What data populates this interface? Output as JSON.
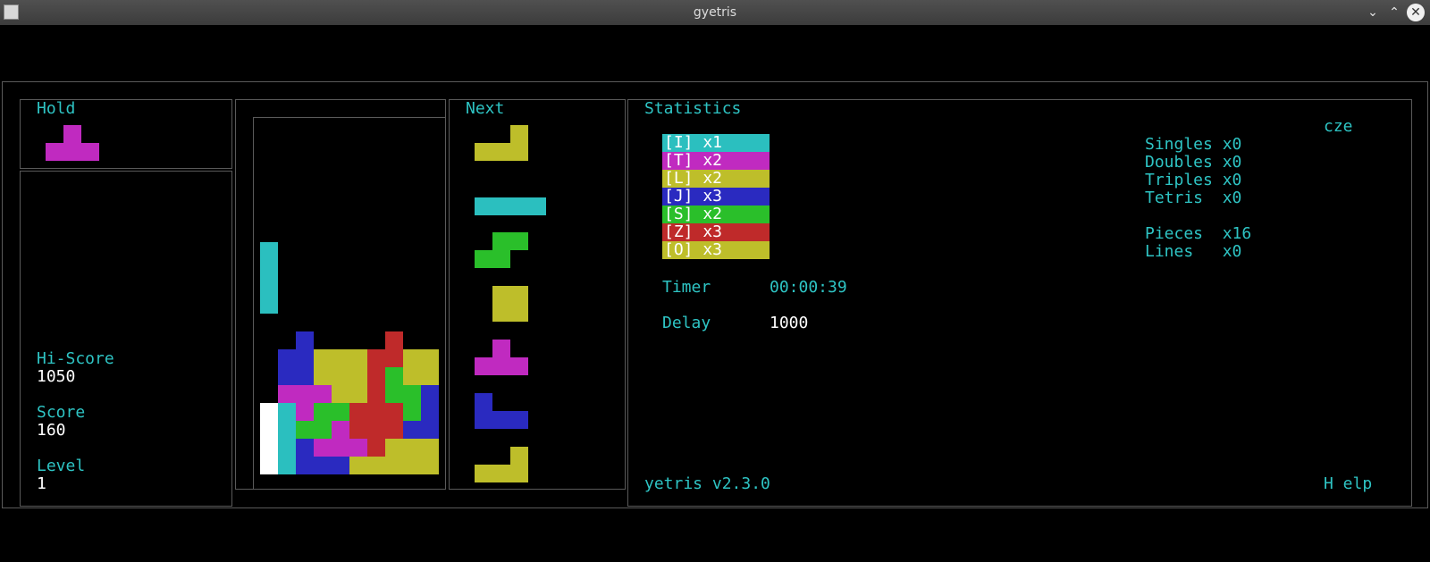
{
  "window": {
    "title": "gyetris"
  },
  "colors": {
    "I": "#2bbfbf",
    "T": "#c02ac0",
    "L": "#bebe2a",
    "J": "#2a2ac0",
    "S": "#2abf2a",
    "Z": "#bf2a2a",
    "O": "#bebe2a",
    "W": "#ffffff",
    "cyanText": "#2ec4c4"
  },
  "hold": {
    "label": "Hold",
    "piece": "T"
  },
  "scores": {
    "hiscore_label": "Hi-Score",
    "hiscore": "1050",
    "score_label": "Score",
    "score": "160",
    "level_label": "Level",
    "level": "1"
  },
  "board": {
    "falling": [
      [
        0,
        7,
        "I"
      ],
      [
        0,
        8,
        "I"
      ],
      [
        0,
        9,
        "I"
      ],
      [
        0,
        10,
        "I"
      ]
    ],
    "cells": [
      [
        2,
        12,
        "J"
      ],
      [
        7,
        12,
        "Z"
      ],
      [
        1,
        13,
        "J"
      ],
      [
        2,
        13,
        "J"
      ],
      [
        3,
        13,
        "L"
      ],
      [
        4,
        13,
        "L"
      ],
      [
        5,
        13,
        "L"
      ],
      [
        6,
        13,
        "Z"
      ],
      [
        7,
        13,
        "Z"
      ],
      [
        8,
        13,
        "L"
      ],
      [
        9,
        13,
        "L"
      ],
      [
        1,
        14,
        "J"
      ],
      [
        2,
        14,
        "J"
      ],
      [
        3,
        14,
        "L"
      ],
      [
        4,
        14,
        "L"
      ],
      [
        5,
        14,
        "L"
      ],
      [
        6,
        14,
        "Z"
      ],
      [
        7,
        14,
        "S"
      ],
      [
        8,
        14,
        "L"
      ],
      [
        9,
        14,
        "L"
      ],
      [
        1,
        15,
        "T"
      ],
      [
        2,
        15,
        "T"
      ],
      [
        3,
        15,
        "T"
      ],
      [
        4,
        15,
        "L"
      ],
      [
        5,
        15,
        "L"
      ],
      [
        6,
        15,
        "Z"
      ],
      [
        7,
        15,
        "S"
      ],
      [
        8,
        15,
        "S"
      ],
      [
        9,
        15,
        "J"
      ],
      [
        0,
        16,
        "W"
      ],
      [
        1,
        16,
        "I"
      ],
      [
        2,
        16,
        "T"
      ],
      [
        3,
        16,
        "S"
      ],
      [
        4,
        16,
        "S"
      ],
      [
        5,
        16,
        "Z"
      ],
      [
        6,
        16,
        "Z"
      ],
      [
        7,
        16,
        "Z"
      ],
      [
        8,
        16,
        "S"
      ],
      [
        9,
        16,
        "J"
      ],
      [
        0,
        17,
        "W"
      ],
      [
        1,
        17,
        "I"
      ],
      [
        2,
        17,
        "S"
      ],
      [
        3,
        17,
        "S"
      ],
      [
        4,
        17,
        "T"
      ],
      [
        5,
        17,
        "Z"
      ],
      [
        6,
        17,
        "Z"
      ],
      [
        7,
        17,
        "Z"
      ],
      [
        8,
        17,
        "J"
      ],
      [
        9,
        17,
        "J"
      ],
      [
        0,
        18,
        "W"
      ],
      [
        1,
        18,
        "I"
      ],
      [
        2,
        18,
        "J"
      ],
      [
        3,
        18,
        "T"
      ],
      [
        4,
        18,
        "T"
      ],
      [
        5,
        18,
        "T"
      ],
      [
        6,
        18,
        "Z"
      ],
      [
        7,
        18,
        "L"
      ],
      [
        8,
        18,
        "L"
      ],
      [
        9,
        18,
        "L"
      ],
      [
        0,
        19,
        "W"
      ],
      [
        1,
        19,
        "I"
      ],
      [
        2,
        19,
        "J"
      ],
      [
        3,
        19,
        "J"
      ],
      [
        4,
        19,
        "J"
      ],
      [
        5,
        19,
        "L"
      ],
      [
        6,
        19,
        "L"
      ],
      [
        7,
        19,
        "L"
      ],
      [
        8,
        19,
        "L"
      ],
      [
        9,
        19,
        "L"
      ]
    ]
  },
  "next": {
    "label": "Next",
    "pieces": [
      "L",
      "I",
      "S",
      "O",
      "T",
      "J",
      "L"
    ]
  },
  "statistics": {
    "label": "Statistics",
    "pieces": [
      {
        "text": "[I] x1",
        "color": "#2bbfbf"
      },
      {
        "text": "[T] x2",
        "color": "#c02ac0"
      },
      {
        "text": "[L] x2",
        "color": "#bebe2a"
      },
      {
        "text": "[J] x3",
        "color": "#2a2ac0"
      },
      {
        "text": "[S] x2",
        "color": "#2abf2a"
      },
      {
        "text": "[Z] x3",
        "color": "#bf2a2a"
      },
      {
        "text": "[O] x3",
        "color": "#bebe2a"
      }
    ],
    "timer_label": "Timer",
    "timer": "00:00:39",
    "delay_label": "Delay",
    "delay": "1000",
    "player": "cze",
    "lines": [
      "Singles x0",
      "Doubles x0",
      "Triples x0",
      "Tetris  x0",
      "",
      "Pieces  x16",
      "Lines   x0"
    ],
    "version": "yetris v2.3.0",
    "help": "H elp"
  }
}
